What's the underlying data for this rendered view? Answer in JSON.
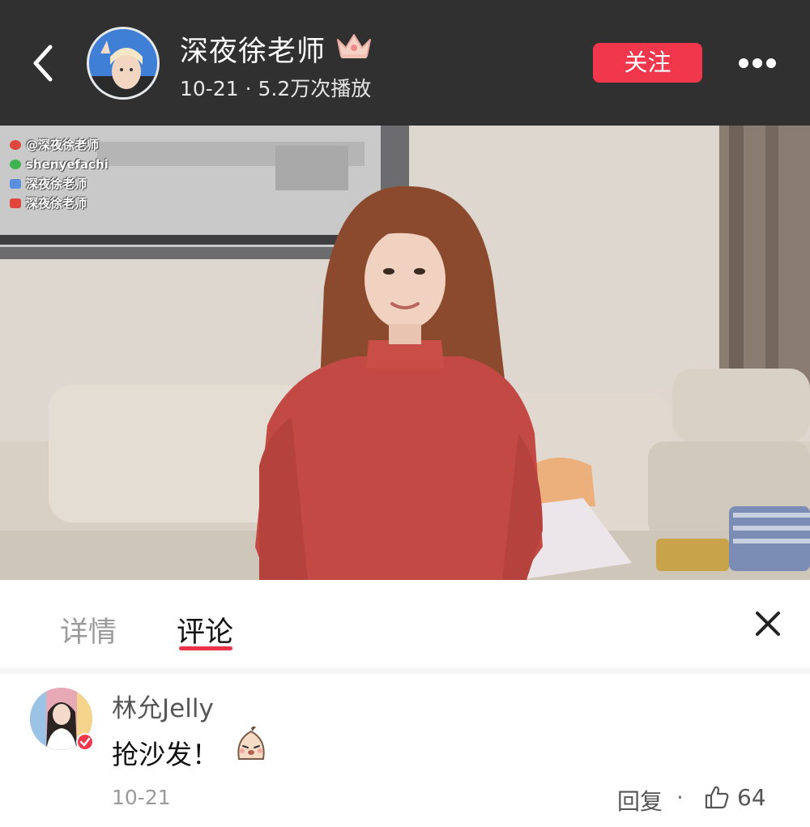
{
  "header": {
    "author_name": "深夜徐老师",
    "meta": "10-21 · 5.2万次播放",
    "follow_label": "关注",
    "icons": [
      "back-arrow-icon",
      "crown-icon",
      "more-icon"
    ]
  },
  "video": {
    "watermark": {
      "weibo": "@深夜徐老师",
      "wechat": "shenyefachi",
      "line3": "深夜徐老师",
      "line4": "深夜徐老师"
    }
  },
  "tabs": [
    {
      "label": "详情",
      "active": false
    },
    {
      "label": "评论",
      "active": true
    }
  ],
  "comments": [
    {
      "user": "林允Jelly",
      "text": "抢沙发！",
      "date": "10-21",
      "reply_label": "回复",
      "separator": "·",
      "likes": "64"
    }
  ],
  "colors": {
    "topbar": "#303030",
    "accent": "#f0374b",
    "tab_underline": "#e8334a"
  }
}
